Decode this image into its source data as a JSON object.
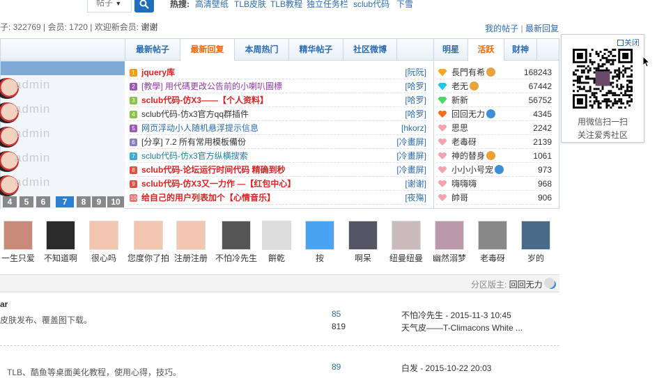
{
  "search": {
    "select_value": "帖子",
    "select_arrow": "▼"
  },
  "hot": {
    "label": "热搜:",
    "links": [
      "高清壁纸",
      "TLB皮肤",
      "TLB教程",
      "独立任务栏",
      "sclub代码",
      "下雪"
    ]
  },
  "stats": {
    "posts_prefix": "子: 322769",
    "members": "会员: 1720",
    "welcome": "欢迎新会员:",
    "new_member": "谢谢"
  },
  "top_links": {
    "my_posts": "我的帖子",
    "latest_replies": "最新回复"
  },
  "tabs": [
    "最新帖子",
    "最新回复",
    "本周热门",
    "精华帖子",
    "社区微博"
  ],
  "rank_tabs": [
    "明星",
    "活跃",
    "财神"
  ],
  "left_avatars": [
    "admin",
    "admin",
    "admin",
    "admin",
    "admin"
  ],
  "pager": [
    "4",
    "5",
    "6",
    "7",
    "8",
    "9",
    "10"
  ],
  "threads": [
    {
      "n": "1",
      "title": "jquery库",
      "author": "[阮阮]",
      "style": "red"
    },
    {
      "n": "2",
      "title": "[教學] 用代碼更改公告前的小喇叭圖標",
      "author": "[哈罗]",
      "style": "purple"
    },
    {
      "n": "3",
      "title": "sclub代码-仿X3——【个人资料】",
      "author": "[哈罗]",
      "style": "red"
    },
    {
      "n": "4",
      "title": "sclub代码-仿x3官方qq群插件",
      "author": "[哈罗]",
      "style": "plain"
    },
    {
      "n": "5",
      "title": "网页浮动小人随机悬浮提示信息",
      "author": "[hkorz]",
      "style": "blue"
    },
    {
      "n": "6",
      "title": "[分享] 7.2 所有常用模板備份",
      "author": "[冷畫屏]",
      "style": "plain"
    },
    {
      "n": "7",
      "title": "sclub代码-仿x3官方纵横搜索",
      "author": "[冷畫屏]",
      "style": "teal"
    },
    {
      "n": "8",
      "title": "sclub代码-论坛运行时间代码 精确到秒",
      "author": "[冷畫屏]",
      "style": "red"
    },
    {
      "n": "9",
      "title": "sclub代码-仿X3又一力作 —【红包中心】",
      "author": "[谢谢]",
      "style": "red"
    },
    {
      "n": "10",
      "title": "给自己的用户列表加个【心情音乐】",
      "author": "[夜殤]",
      "style": "red"
    }
  ],
  "number_colors": [
    "#f39c12",
    "#9b59b6",
    "#8bc34a",
    "#8bc34a",
    "#9b59b6",
    "#8e7cc3",
    "#3fa9d7",
    "#e74c3c",
    "#e74c3c",
    "#f07070"
  ],
  "ranking": [
    {
      "name": "長門有希",
      "value": "168243",
      "icon": "orange-gem-icon"
    },
    {
      "name": "老无",
      "value": "67442",
      "icon": "cyan-gem-icon"
    },
    {
      "name": "新新",
      "value": "56752",
      "icon": "green-gem-icon"
    },
    {
      "name": "回回无力",
      "value": "4345",
      "icon": "orange-heart-icon"
    },
    {
      "name": "思思",
      "value": "2242",
      "icon": "pink-heart-icon"
    },
    {
      "name": "老毒砑",
      "value": "2139",
      "icon": "pink-heart-icon"
    },
    {
      "name": "神的替身",
      "value": "1061",
      "icon": "pink-heart-icon"
    },
    {
      "name": "小小小号宠",
      "value": "973",
      "icon": "pink-heart-icon"
    },
    {
      "name": "嗨嗨嗨",
      "value": "968",
      "icon": "pink-heart-icon"
    },
    {
      "name": "帥哥",
      "value": "906",
      "icon": "pink-heart-icon"
    }
  ],
  "avatars": [
    "一生只爱",
    "不知道啊",
    "很心吗",
    "您度你了拍",
    "注册注册",
    "不怕冷先生",
    "餠乾",
    "按",
    "啊呆",
    "纽曼纽曼",
    "幽然溺梦",
    "老毒砑",
    "岁的"
  ],
  "section": {
    "moderator_label": "分区版主:",
    "moderator": "回回无力"
  },
  "forums": [
    {
      "name": "ar",
      "desc": "皮肤发布、覆盖图下载。",
      "topics": "85",
      "posts": "819",
      "last_user": "不怕冷先生 - 2015-11-3 10:45",
      "last_title": "天气皮——T-Climacons White ..."
    },
    {
      "name": "",
      "desc": "TLB、酷鱼等桌面美化教程，使用心得，技巧。",
      "topics": "89",
      "posts": "",
      "last_user": "白发 - 2015-10-22 20:03",
      "last_title": ""
    }
  ],
  "qr": {
    "close": "关闭",
    "line1": "用微信扫一扫",
    "line2": "关注爱秀社区"
  },
  "colors": {
    "accent": "#2a6bb1",
    "active_tab": "#ff6600",
    "red_title": "#dd2222"
  }
}
